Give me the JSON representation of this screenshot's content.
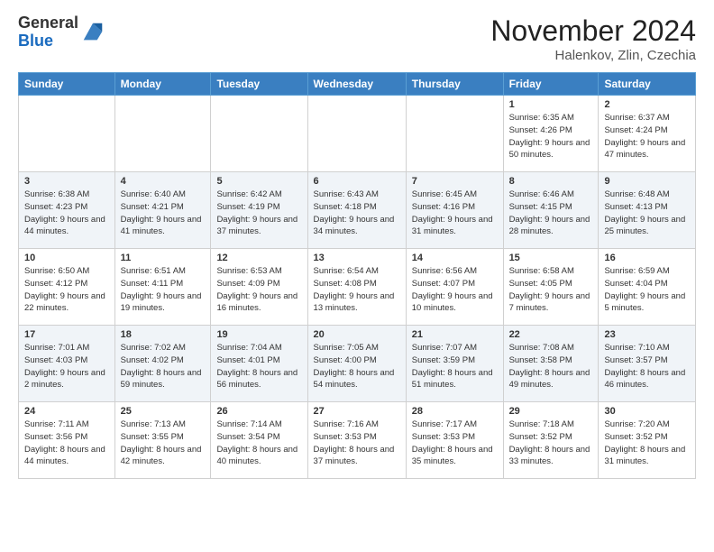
{
  "header": {
    "logo_general": "General",
    "logo_blue": "Blue",
    "title": "November 2024",
    "subtitle": "Halenkov, Zlin, Czechia"
  },
  "columns": [
    "Sunday",
    "Monday",
    "Tuesday",
    "Wednesday",
    "Thursday",
    "Friday",
    "Saturday"
  ],
  "rows": [
    [
      {
        "day": "",
        "info": ""
      },
      {
        "day": "",
        "info": ""
      },
      {
        "day": "",
        "info": ""
      },
      {
        "day": "",
        "info": ""
      },
      {
        "day": "",
        "info": ""
      },
      {
        "day": "1",
        "info": "Sunrise: 6:35 AM\nSunset: 4:26 PM\nDaylight: 9 hours and 50 minutes."
      },
      {
        "day": "2",
        "info": "Sunrise: 6:37 AM\nSunset: 4:24 PM\nDaylight: 9 hours and 47 minutes."
      }
    ],
    [
      {
        "day": "3",
        "info": "Sunrise: 6:38 AM\nSunset: 4:23 PM\nDaylight: 9 hours and 44 minutes."
      },
      {
        "day": "4",
        "info": "Sunrise: 6:40 AM\nSunset: 4:21 PM\nDaylight: 9 hours and 41 minutes."
      },
      {
        "day": "5",
        "info": "Sunrise: 6:42 AM\nSunset: 4:19 PM\nDaylight: 9 hours and 37 minutes."
      },
      {
        "day": "6",
        "info": "Sunrise: 6:43 AM\nSunset: 4:18 PM\nDaylight: 9 hours and 34 minutes."
      },
      {
        "day": "7",
        "info": "Sunrise: 6:45 AM\nSunset: 4:16 PM\nDaylight: 9 hours and 31 minutes."
      },
      {
        "day": "8",
        "info": "Sunrise: 6:46 AM\nSunset: 4:15 PM\nDaylight: 9 hours and 28 minutes."
      },
      {
        "day": "9",
        "info": "Sunrise: 6:48 AM\nSunset: 4:13 PM\nDaylight: 9 hours and 25 minutes."
      }
    ],
    [
      {
        "day": "10",
        "info": "Sunrise: 6:50 AM\nSunset: 4:12 PM\nDaylight: 9 hours and 22 minutes."
      },
      {
        "day": "11",
        "info": "Sunrise: 6:51 AM\nSunset: 4:11 PM\nDaylight: 9 hours and 19 minutes."
      },
      {
        "day": "12",
        "info": "Sunrise: 6:53 AM\nSunset: 4:09 PM\nDaylight: 9 hours and 16 minutes."
      },
      {
        "day": "13",
        "info": "Sunrise: 6:54 AM\nSunset: 4:08 PM\nDaylight: 9 hours and 13 minutes."
      },
      {
        "day": "14",
        "info": "Sunrise: 6:56 AM\nSunset: 4:07 PM\nDaylight: 9 hours and 10 minutes."
      },
      {
        "day": "15",
        "info": "Sunrise: 6:58 AM\nSunset: 4:05 PM\nDaylight: 9 hours and 7 minutes."
      },
      {
        "day": "16",
        "info": "Sunrise: 6:59 AM\nSunset: 4:04 PM\nDaylight: 9 hours and 5 minutes."
      }
    ],
    [
      {
        "day": "17",
        "info": "Sunrise: 7:01 AM\nSunset: 4:03 PM\nDaylight: 9 hours and 2 minutes."
      },
      {
        "day": "18",
        "info": "Sunrise: 7:02 AM\nSunset: 4:02 PM\nDaylight: 8 hours and 59 minutes."
      },
      {
        "day": "19",
        "info": "Sunrise: 7:04 AM\nSunset: 4:01 PM\nDaylight: 8 hours and 56 minutes."
      },
      {
        "day": "20",
        "info": "Sunrise: 7:05 AM\nSunset: 4:00 PM\nDaylight: 8 hours and 54 minutes."
      },
      {
        "day": "21",
        "info": "Sunrise: 7:07 AM\nSunset: 3:59 PM\nDaylight: 8 hours and 51 minutes."
      },
      {
        "day": "22",
        "info": "Sunrise: 7:08 AM\nSunset: 3:58 PM\nDaylight: 8 hours and 49 minutes."
      },
      {
        "day": "23",
        "info": "Sunrise: 7:10 AM\nSunset: 3:57 PM\nDaylight: 8 hours and 46 minutes."
      }
    ],
    [
      {
        "day": "24",
        "info": "Sunrise: 7:11 AM\nSunset: 3:56 PM\nDaylight: 8 hours and 44 minutes."
      },
      {
        "day": "25",
        "info": "Sunrise: 7:13 AM\nSunset: 3:55 PM\nDaylight: 8 hours and 42 minutes."
      },
      {
        "day": "26",
        "info": "Sunrise: 7:14 AM\nSunset: 3:54 PM\nDaylight: 8 hours and 40 minutes."
      },
      {
        "day": "27",
        "info": "Sunrise: 7:16 AM\nSunset: 3:53 PM\nDaylight: 8 hours and 37 minutes."
      },
      {
        "day": "28",
        "info": "Sunrise: 7:17 AM\nSunset: 3:53 PM\nDaylight: 8 hours and 35 minutes."
      },
      {
        "day": "29",
        "info": "Sunrise: 7:18 AM\nSunset: 3:52 PM\nDaylight: 8 hours and 33 minutes."
      },
      {
        "day": "30",
        "info": "Sunrise: 7:20 AM\nSunset: 3:52 PM\nDaylight: 8 hours and 31 minutes."
      }
    ]
  ]
}
